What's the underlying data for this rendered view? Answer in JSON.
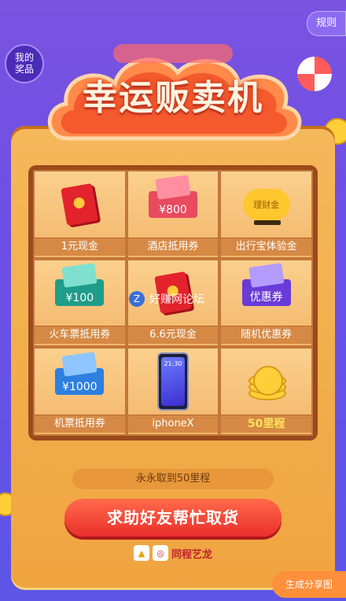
{
  "header": {
    "my_prizes": "我的\n奖品",
    "rules": "规则",
    "title": "幸运贩卖机"
  },
  "prizes": [
    {
      "name": "1元现金",
      "icon": "red-envelope-icon"
    },
    {
      "name": "酒店抵用券",
      "icon": "hotel-coupon-icon",
      "amount": "¥800"
    },
    {
      "name": "出行宝体验金",
      "icon": "piggy-bank-icon",
      "badge": "理财金"
    },
    {
      "name": "火车票抵用券",
      "icon": "train-coupon-icon",
      "amount": "¥100"
    },
    {
      "name": "6.6元现金",
      "icon": "red-envelope-icon"
    },
    {
      "name": "随机优惠券",
      "icon": "coupon-icon",
      "badge": "优惠券"
    },
    {
      "name": "机票抵用券",
      "icon": "flight-coupon-icon",
      "amount": "¥1000"
    },
    {
      "name": "iphoneX",
      "icon": "phone-icon",
      "screen_time": "21:30"
    },
    {
      "name": "50里程",
      "icon": "coins-icon"
    }
  ],
  "status": {
    "mileage_text": "永永取到50里程"
  },
  "actions": {
    "help_button": "求助好友帮忙取货",
    "share": "生成分享图"
  },
  "brand": {
    "name": "同程艺龙"
  },
  "watermark": {
    "text": "好赚网论坛",
    "badge": "Z"
  },
  "colors": {
    "accent_red": "#ea2f2c",
    "machine_orange": "#f0a440",
    "background_purple": "#6d4fe6"
  }
}
